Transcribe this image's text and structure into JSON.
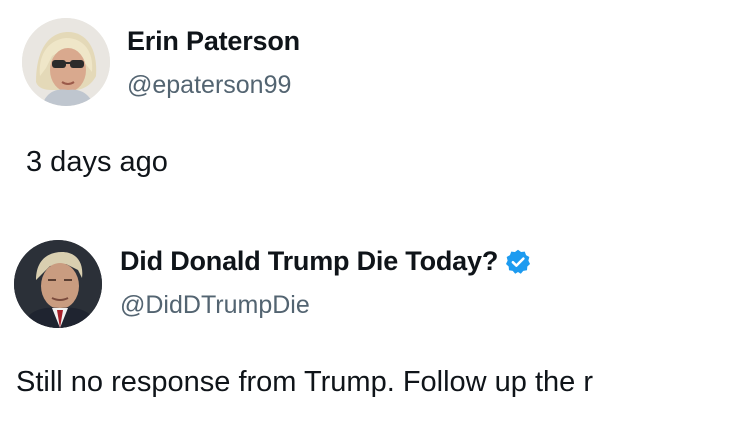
{
  "posts": [
    {
      "display_name": "Erin Paterson",
      "handle": "@epaterson99",
      "avatar_icon": "avatar-woman-sunglasses",
      "timestamp": "3 days ago"
    },
    {
      "display_name": "Did Donald Trump Die Today?",
      "handle": "@DidDTrumpDie",
      "avatar_icon": "avatar-man-portrait",
      "verified": true,
      "verified_icon": "verified-badge-icon",
      "verified_color": "#1d9bf0",
      "text": "Still no response from Trump. Follow up the r"
    }
  ],
  "colors": {
    "text_primary": "#0f1419",
    "text_secondary": "#536471",
    "background": "#ffffff",
    "accent": "#1d9bf0"
  }
}
